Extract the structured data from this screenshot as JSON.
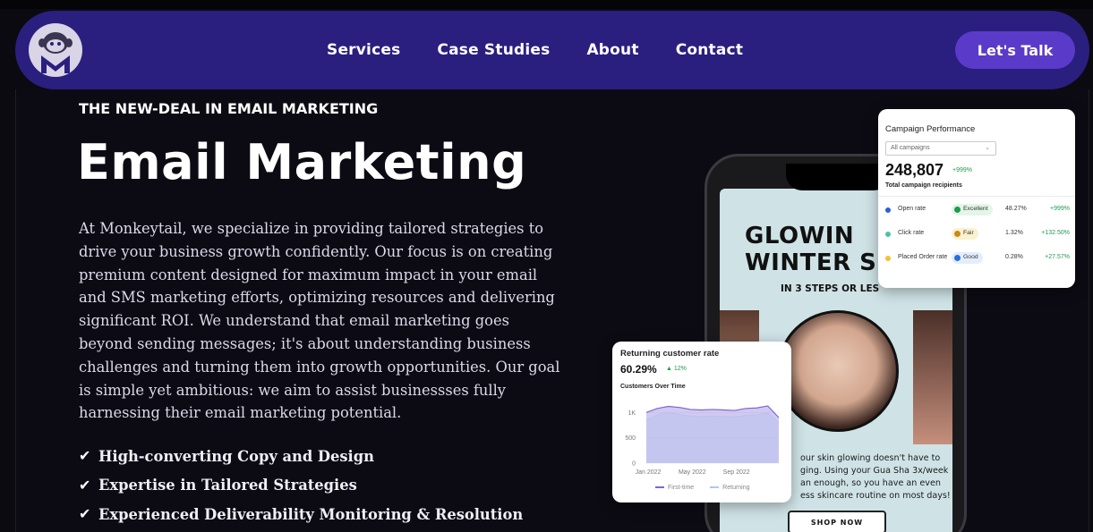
{
  "brand": {
    "logo_name": "Monkeytail"
  },
  "nav": {
    "links": [
      "Services",
      "Case Studies",
      "About",
      "Contact"
    ],
    "cta_label": "Let's Talk"
  },
  "hero": {
    "eyebrow": "THE NEW-DEAL IN EMAIL MARKETING",
    "title": "Email Marketing",
    "body": "At Monkeytail, we specialize in providing tailored strategies to drive your business growth confidently. Our focus is on creating premium content designed for maximum impact in your email and SMS marketing efforts, optimizing resources and delivering significant ROI. We understand that email marketing goes beyond sending messages; it's about understanding business challenges and turning them into growth opportunities. Our goal is simple yet ambitious: we aim to assist businessses fully harnessing their email marketing potential.",
    "features": [
      "High-converting Copy and Design",
      "Expertise in Tailored Strategies",
      "Experienced Deliverability Monitoring & Resolution"
    ]
  },
  "phone": {
    "title": "GLOWIN\nWINTER S",
    "subtitle": "IN 3 STEPS OR LES",
    "body": "our skin glowing doesn't have to ging. Using your Gua Sha 3x/week an enough, so you have an even ess skincare routine on most days!",
    "button": "SHOP NOW"
  },
  "campaign_card": {
    "title": "Campaign Performance",
    "select_value": "All campaigns",
    "total": "248,807",
    "total_delta": "+999%",
    "total_label": "Total campaign recipients",
    "rows": [
      {
        "label": "Open rate",
        "badge": "Excellent",
        "value": "48.27%",
        "delta": "+999%",
        "dot_color": "#2c5fd6",
        "badge_bg": "#e3f6e8",
        "badge_dot": "#1e9b4c"
      },
      {
        "label": "Click rate",
        "badge": "Fair",
        "value": "1.32%",
        "delta": "+132.50%",
        "dot_color": "#46c6a8",
        "badge_bg": "#fbf1cf",
        "badge_dot": "#c58b1a"
      },
      {
        "label": "Placed Order rate",
        "badge": "Good",
        "value": "0.28%",
        "delta": "+27.57%",
        "dot_color": "#f2c230",
        "badge_bg": "#e3eefc",
        "badge_dot": "#2c6fd6"
      }
    ]
  },
  "returning_card": {
    "title": "Returning customer rate",
    "value": "60.29%",
    "delta": "12%",
    "chart_title": "Customers Over Time",
    "legend": [
      "First-time",
      "Returning"
    ]
  },
  "chart_data": {
    "type": "area",
    "title": "Customers Over Time",
    "y_ticks": [
      "0",
      "500",
      "1K"
    ],
    "ylim": [
      0,
      1200
    ],
    "x_ticks": [
      "Jan 2022",
      "May 2022",
      "Sep 2022"
    ],
    "x": [
      0,
      1,
      2,
      3,
      4,
      5,
      6,
      7,
      8,
      9,
      10,
      11,
      12
    ],
    "series": [
      {
        "name": "First-time",
        "values": [
          1000,
          1080,
          1120,
          1100,
          1060,
          1050,
          1060,
          1050,
          1040,
          1080,
          1090,
          1130,
          900
        ],
        "color": "#7e65d8"
      },
      {
        "name": "Returning",
        "values": [
          850,
          950,
          1000,
          960,
          930,
          920,
          930,
          920,
          910,
          940,
          950,
          990,
          800
        ],
        "color": "#b6c4ef"
      }
    ]
  }
}
